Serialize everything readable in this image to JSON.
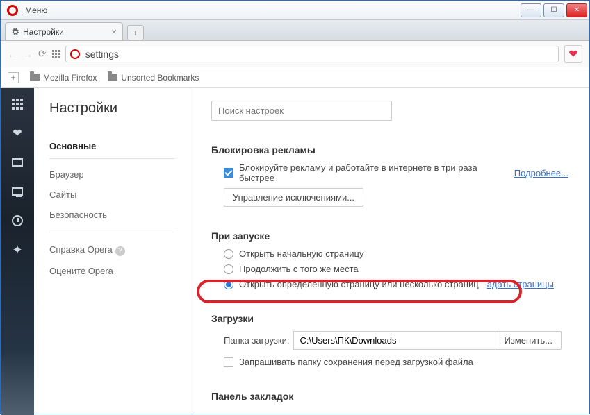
{
  "window": {
    "menu_label": "Меню"
  },
  "tabs": {
    "settings_label": "Настройки"
  },
  "address": {
    "value": "settings"
  },
  "bookmarks": {
    "items": [
      {
        "label": "Mozilla Firefox"
      },
      {
        "label": "Unsorted Bookmarks"
      }
    ]
  },
  "settings_nav": {
    "title": "Настройки",
    "items": {
      "basic": "Основные",
      "browser": "Браузер",
      "sites": "Сайты",
      "security": "Безопасность",
      "help": "Справка Opera",
      "rate": "Оцените Opera"
    }
  },
  "content": {
    "search_placeholder": "Поиск настроек",
    "adblock": {
      "heading": "Блокировка рекламы",
      "checkbox_label": "Блокируйте рекламу и работайте в интернете в три раза быстрее",
      "more_link": "Подробнее...",
      "manage_btn": "Управление исключениями..."
    },
    "startup": {
      "heading": "При запуске",
      "opt_home": "Открыть начальную страницу",
      "opt_continue": "Продолжить с того же места",
      "opt_specific": "Открыть определенную страницу или несколько страниц",
      "set_pages_link": "адать страницы"
    },
    "downloads": {
      "heading": "Загрузки",
      "folder_label": "Папка загрузки:",
      "folder_value": "C:\\Users\\ПК\\Downloads",
      "change_btn": "Изменить...",
      "ask_label": "Запрашивать папку сохранения перед загрузкой файла"
    },
    "bookmarks_panel": {
      "heading": "Панель закладок"
    }
  }
}
